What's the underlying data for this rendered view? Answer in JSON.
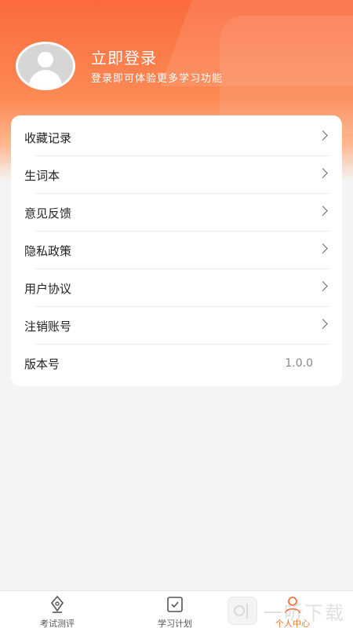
{
  "header": {
    "login_title": "立即登录",
    "login_subtitle": "登录即可体验更多学习功能"
  },
  "menu": {
    "items": [
      {
        "label": "收藏记录"
      },
      {
        "label": "生词本"
      },
      {
        "label": "意见反馈"
      },
      {
        "label": "隐私政策"
      },
      {
        "label": "用户协议"
      },
      {
        "label": "注销账号"
      }
    ],
    "version_label": "版本号",
    "version_value": "1.0.0"
  },
  "tabbar": {
    "tabs": [
      {
        "label": "考试测评",
        "icon": "pen-nib-icon"
      },
      {
        "label": "学习计划",
        "icon": "checklist-icon"
      },
      {
        "label": "个人中心",
        "icon": "user-icon",
        "active": true
      }
    ]
  },
  "watermark": {
    "text": "一听下载"
  },
  "colors": {
    "accent": "#f07234",
    "header_top": "#fb6a3c",
    "header_bottom": "#fdb790",
    "background": "#f4f4f4"
  }
}
